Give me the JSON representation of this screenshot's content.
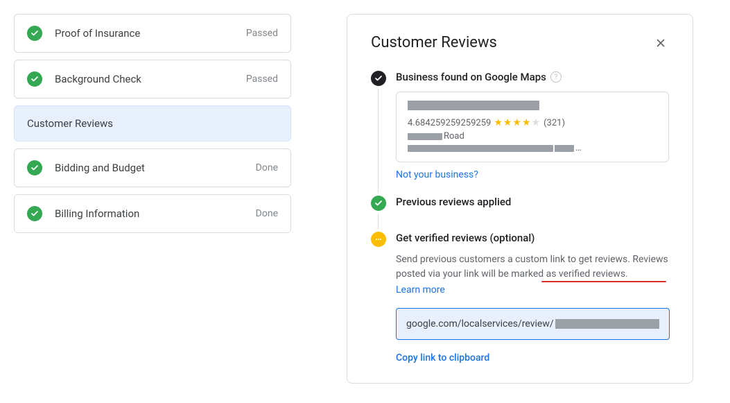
{
  "steps": [
    {
      "label": "Proof of Insurance",
      "status": "Passed",
      "icon": "check",
      "active": false
    },
    {
      "label": "Background Check",
      "status": "Passed",
      "icon": "check",
      "active": false
    },
    {
      "label": "Customer Reviews",
      "status": "",
      "icon": "",
      "active": true
    },
    {
      "label": "Bidding and Budget",
      "status": "Done",
      "icon": "check",
      "active": false
    },
    {
      "label": "Billing Information",
      "status": "Done",
      "icon": "check",
      "active": false
    }
  ],
  "panel": {
    "title": "Customer Reviews",
    "section1": {
      "heading": "Business found on Google Maps",
      "rating_value": "4.684259259259259",
      "review_count": "(321)",
      "addr_suffix": "Road",
      "not_your_business": "Not your business?"
    },
    "section2": {
      "heading": "Previous reviews applied"
    },
    "section3": {
      "heading": "Get verified reviews (optional)",
      "desc": "Send previous customers a custom link to get reviews. Reviews posted via your link will be marked as verified reviews.",
      "learn_more": "Learn more",
      "link_prefix": "google.com/localservices/review/",
      "copy_label": "Copy link to clipboard"
    }
  }
}
